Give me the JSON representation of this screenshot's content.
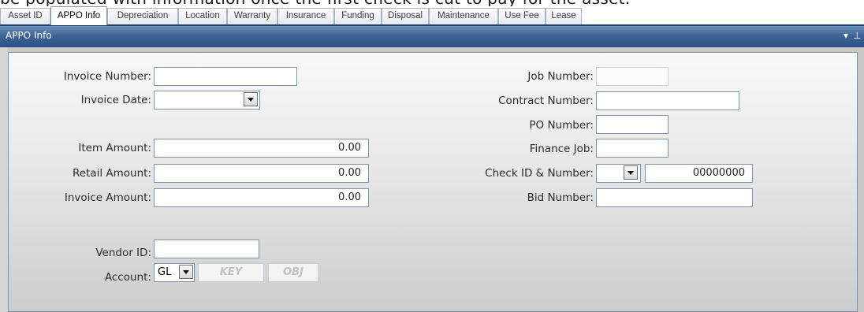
{
  "caption": "be populated with information once the first check is cut to pay for the asset.",
  "tabs": [
    {
      "label": "Asset ID",
      "active": false
    },
    {
      "label": "APPO Info",
      "active": true
    },
    {
      "label": "Depreciation",
      "active": false
    },
    {
      "label": "Location",
      "active": false
    },
    {
      "label": "Warranty",
      "active": false
    },
    {
      "label": "Insurance",
      "active": false
    },
    {
      "label": "Funding",
      "active": false
    },
    {
      "label": "Disposal",
      "active": false
    },
    {
      "label": "Maintenance",
      "active": false
    },
    {
      "label": "Use Fee",
      "active": false
    },
    {
      "label": "Lease",
      "active": false
    }
  ],
  "panel": {
    "title": "APPO Info",
    "pin_glyph": "▾ ⊥ ✕"
  },
  "left": {
    "invoice_number": {
      "label": "Invoice Number:",
      "value": ""
    },
    "invoice_date": {
      "label": "Invoice Date:",
      "value": ""
    },
    "item_amount": {
      "label": "Item Amount:",
      "value": "0.00"
    },
    "retail_amount": {
      "label": "Retail Amount:",
      "value": "0.00"
    },
    "invoice_amount": {
      "label": "Invoice Amount:",
      "value": "0.00"
    },
    "vendor_id": {
      "label": "Vendor ID:",
      "value": ""
    },
    "account": {
      "label": "Account:",
      "type": "GL",
      "key_placeholder": "KEY",
      "obj_placeholder": "OBJ"
    }
  },
  "right": {
    "job_number": {
      "label": "Job Number:",
      "value": ""
    },
    "contract_number": {
      "label": "Contract Number:",
      "value": ""
    },
    "po_number": {
      "label": "PO Number:",
      "value": ""
    },
    "finance_job": {
      "label": "Finance Job:",
      "value": ""
    },
    "check_id": {
      "label": "Check ID & Number:",
      "id_value": "",
      "number_value": "00000000"
    },
    "bid_number": {
      "label": "Bid Number:",
      "value": ""
    }
  },
  "colors": {
    "header": "#3f6596",
    "tab_line": "#20466f",
    "field_border": "#7d93ad"
  }
}
